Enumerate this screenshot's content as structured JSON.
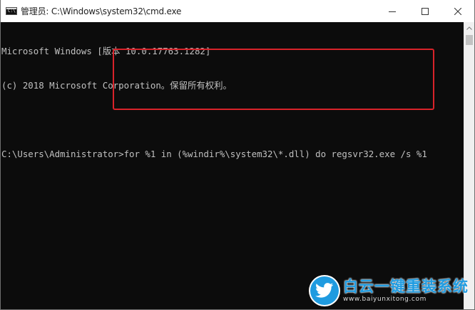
{
  "window": {
    "title": "管理员: C:\\Windows\\system32\\cmd.exe",
    "icon_glyph": "C:\\",
    "icon_name": "cmd-app-icon",
    "controls": [
      "minimize-icon",
      "maximize-icon",
      "close-icon"
    ]
  },
  "console": {
    "lines": [
      "Microsoft Windows [版本 10.0.17763.1282]",
      "(c) 2018 Microsoft Corporation。保留所有权利。",
      "",
      "C:\\Users\\Administrator>for %1 in (%windir%\\system32\\*.dll) do regsvr32.exe /s %1"
    ]
  },
  "annotation": {
    "color": "#d8232a"
  },
  "watermark": {
    "brand": "白云一键重装系统",
    "url": "www.baiyunxitong.com",
    "color": "#1f9be0"
  }
}
